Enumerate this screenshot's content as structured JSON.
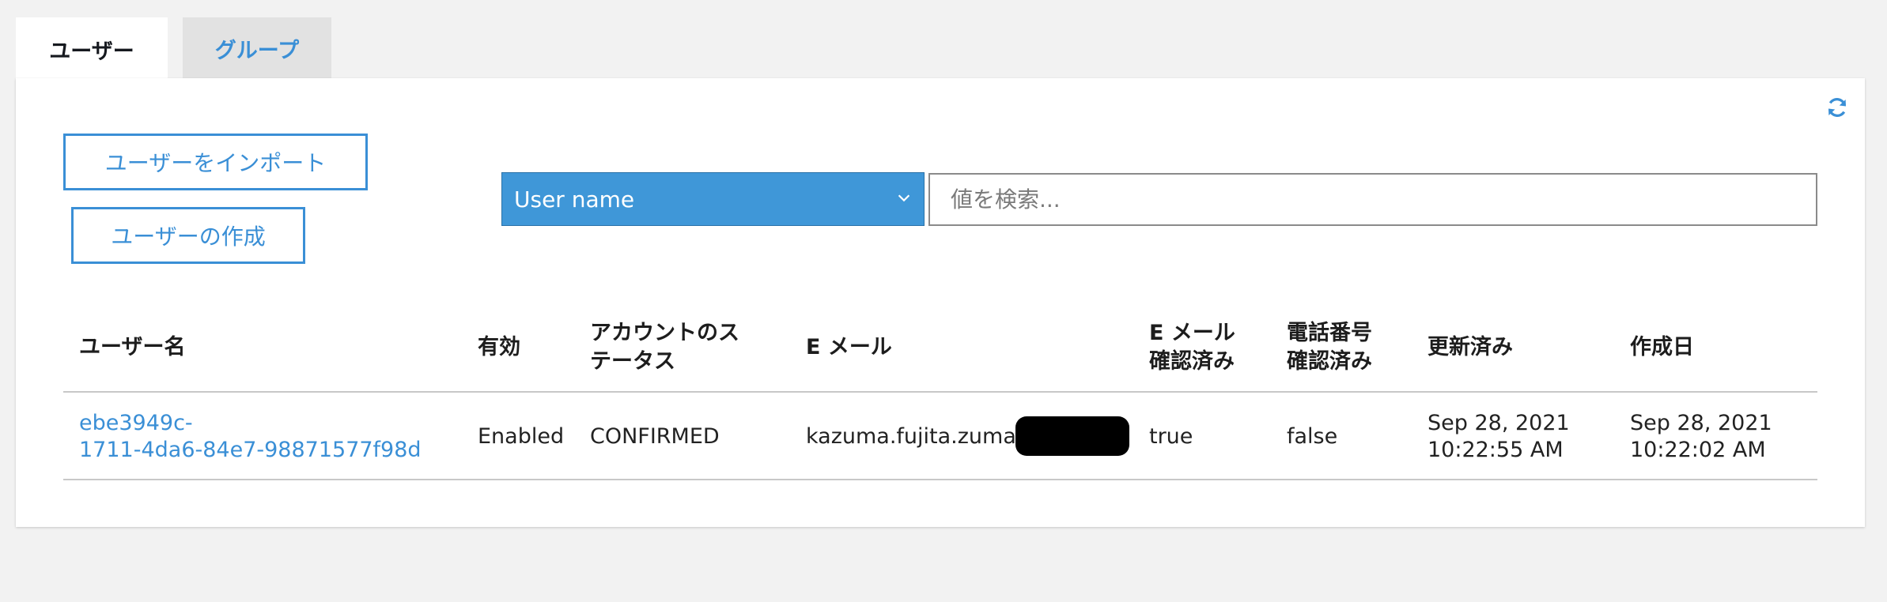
{
  "tabs": [
    {
      "label": "ユーザー",
      "active": true
    },
    {
      "label": "グループ",
      "active": false
    }
  ],
  "toolbar": {
    "import_label": "ユーザーをインポート",
    "create_label": "ユーザーの作成",
    "refresh_icon": "refresh-icon"
  },
  "search": {
    "attribute_selected": "User name",
    "placeholder": "値を検索..."
  },
  "table": {
    "headers": {
      "username": "ユーザー名",
      "enabled": "有効",
      "status_line1": "アカウントのス",
      "status_line2": "テータス",
      "email": "E メール",
      "email_verified_line1": "E メール",
      "email_verified_line2": "確認済み",
      "phone_verified_line1": "電話番号",
      "phone_verified_line2": "確認済み",
      "updated": "更新済み",
      "created": "作成日"
    },
    "rows": [
      {
        "username_line1": "ebe3949c-",
        "username_line2": "1711-4da6-84e7-98871577f98d",
        "enabled": "Enabled",
        "status": "CONFIRMED",
        "email": "kazuma.fujita.zuma@",
        "email_verified": "true",
        "phone_verified": "false",
        "updated_line1": "Sep 28, 2021",
        "updated_line2": "10:22:55 AM",
        "created_line1": "Sep 28, 2021",
        "created_line2": "10:22:02 AM"
      }
    ]
  },
  "colors": {
    "accent": "#3a8fd6",
    "select_bg": "#3f97d8",
    "page_bg": "#f2f2f2"
  }
}
